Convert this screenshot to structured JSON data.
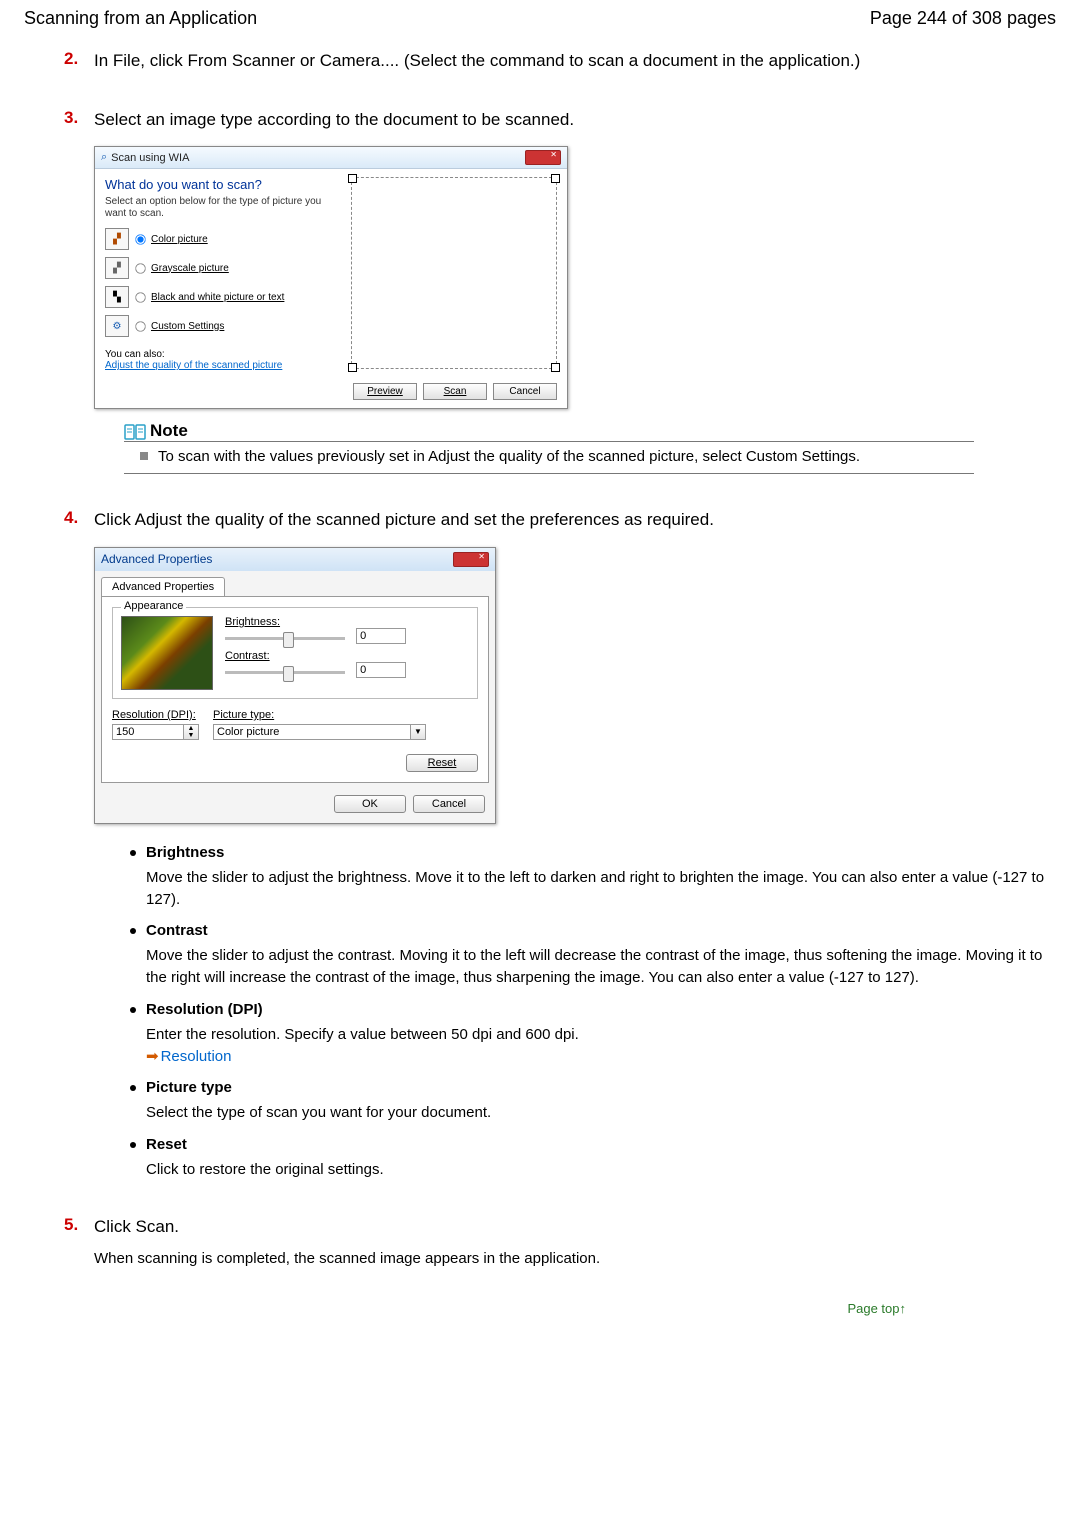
{
  "header": {
    "left": "Scanning from an Application",
    "right": "Page 244 of 308 pages"
  },
  "steps": {
    "s2": {
      "num": "2.",
      "text": "In File, click From Scanner or Camera.... (Select the command to scan a document in the application.)"
    },
    "s3": {
      "num": "3.",
      "text": "Select an image type according to the document to be scanned."
    },
    "s4": {
      "num": "4.",
      "text": "Click Adjust the quality of the scanned picture and set the preferences as required."
    },
    "s5": {
      "num": "5.",
      "text": "Click Scan."
    }
  },
  "wia": {
    "title": "Scan using WIA",
    "question": "What do you want to scan?",
    "subtext": "Select an option below for the type of picture you want to scan.",
    "opts": {
      "color": "Color picture",
      "gray": "Grayscale picture",
      "bw": "Black and white picture or text",
      "custom": "Custom Settings"
    },
    "also": "You can also:",
    "adjust_link": "Adjust the quality of the scanned picture",
    "buttons": {
      "preview": "Preview",
      "scan": "Scan",
      "cancel": "Cancel"
    }
  },
  "note": {
    "title": "Note",
    "body": "To scan with the values previously set in Adjust the quality of the scanned picture, select Custom Settings."
  },
  "adv": {
    "title": "Advanced Properties",
    "tab": "Advanced Properties",
    "group": "Appearance",
    "brightness_label": "Brightness:",
    "contrast_label": "Contrast:",
    "brightness_val": "0",
    "contrast_val": "0",
    "resolution_label": "Resolution (DPI):",
    "resolution_val": "150",
    "picture_type_label": "Picture type:",
    "picture_type_val": "Color picture",
    "reset": "Reset",
    "ok": "OK",
    "cancel": "Cancel"
  },
  "defs": {
    "brightness": {
      "term": "Brightness",
      "desc": "Move the slider to adjust the brightness. Move it to the left to darken and right to brighten the image. You can also enter a value (-127 to 127)."
    },
    "contrast": {
      "term": "Contrast",
      "desc": "Move the slider to adjust the contrast. Moving it to the left will decrease the contrast of the image, thus softening the image. Moving it to the right will increase the contrast of the image, thus sharpening the image. You can also enter a value (-127 to 127)."
    },
    "resolution": {
      "term": "Resolution (DPI)",
      "desc": "Enter the resolution. Specify a value between 50 dpi and 600 dpi.",
      "link": "Resolution"
    },
    "type": {
      "term": "Picture type",
      "desc": "Select the type of scan you want for your document."
    },
    "reset": {
      "term": "Reset",
      "desc": "Click to restore the original settings."
    }
  },
  "final_sub": "When scanning is completed, the scanned image appears in the application.",
  "page_top": "Page top"
}
